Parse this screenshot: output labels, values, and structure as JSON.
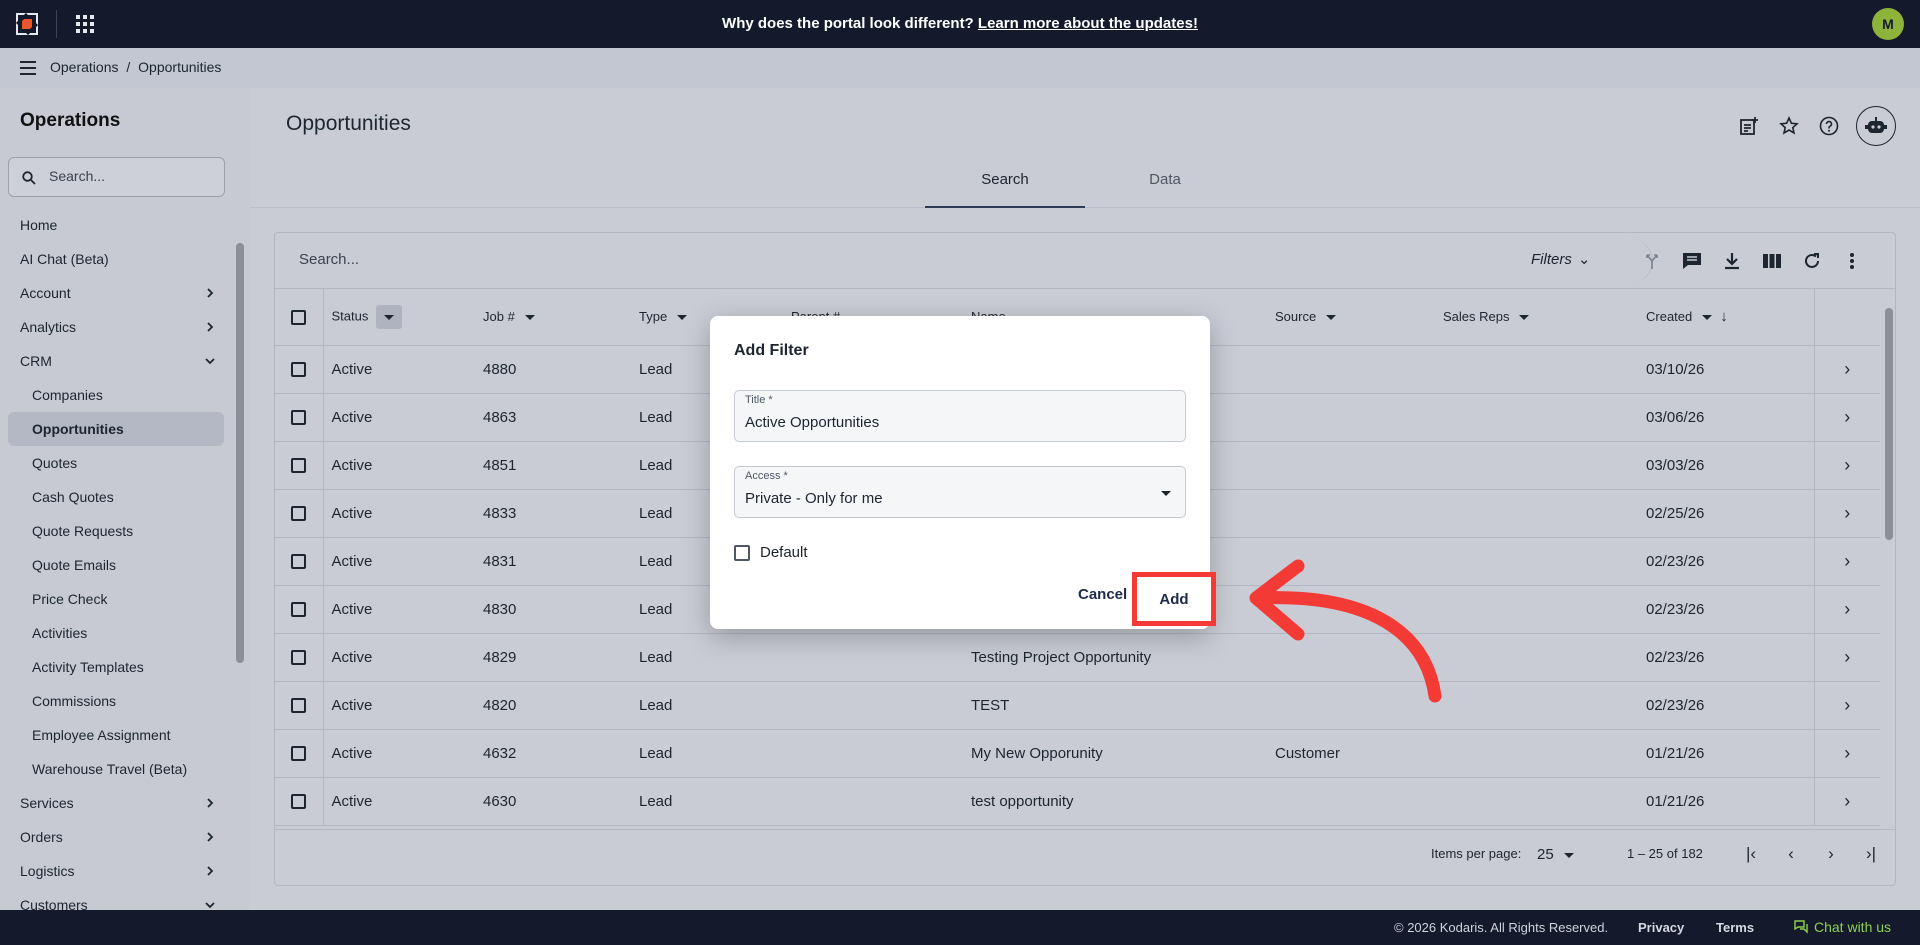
{
  "topbar": {
    "notice_text": "Why does the portal look different?",
    "notice_link": "Learn more about the updates!",
    "avatar_initial": "M"
  },
  "breadcrumb": {
    "root": "Operations",
    "separator": "/",
    "current": "Opportunities"
  },
  "sidebar": {
    "title": "Operations",
    "search_placeholder": "Search...",
    "items": [
      {
        "label": "Home",
        "level": 0
      },
      {
        "label": "AI Chat (Beta)",
        "level": 0
      },
      {
        "label": "Account",
        "level": 0,
        "chevron": "right"
      },
      {
        "label": "Analytics",
        "level": 0,
        "chevron": "right"
      },
      {
        "label": "CRM",
        "level": 0,
        "chevron": "down"
      },
      {
        "label": "Companies",
        "level": 1
      },
      {
        "label": "Opportunities",
        "level": 1,
        "active": true
      },
      {
        "label": "Quotes",
        "level": 1
      },
      {
        "label": "Cash Quotes",
        "level": 1
      },
      {
        "label": "Quote Requests",
        "level": 1
      },
      {
        "label": "Quote Emails",
        "level": 1
      },
      {
        "label": "Price Check",
        "level": 1
      },
      {
        "label": "Activities",
        "level": 1
      },
      {
        "label": "Activity Templates",
        "level": 1
      },
      {
        "label": "Commissions",
        "level": 1
      },
      {
        "label": "Employee Assignment",
        "level": 1
      },
      {
        "label": "Warehouse Travel (Beta)",
        "level": 1
      },
      {
        "label": "Services",
        "level": 0,
        "chevron": "right"
      },
      {
        "label": "Orders",
        "level": 0,
        "chevron": "right"
      },
      {
        "label": "Logistics",
        "level": 0,
        "chevron": "right"
      },
      {
        "label": "Customers",
        "level": 0,
        "chevron": "down"
      }
    ]
  },
  "main": {
    "page_title": "Opportunities",
    "tabs": [
      {
        "label": "Search",
        "active": true
      },
      {
        "label": "Data",
        "active": false
      }
    ],
    "search_placeholder": "Search...",
    "filters_label": "Filters"
  },
  "table": {
    "columns": [
      "Status",
      "Job #",
      "Type",
      "Parent #",
      "Name",
      "Source",
      "Sales Reps",
      "Created"
    ],
    "rows": [
      {
        "status": "Active",
        "job": "4880",
        "type": "Lead",
        "name": "",
        "source": "",
        "created": "03/10/26"
      },
      {
        "status": "Active",
        "job": "4863",
        "type": "Lead",
        "name": "",
        "source": "",
        "created": "03/06/26"
      },
      {
        "status": "Active",
        "job": "4851",
        "type": "Lead",
        "name": "",
        "source": "",
        "created": "03/03/26"
      },
      {
        "status": "Active",
        "job": "4833",
        "type": "Lead",
        "name": "",
        "source": "",
        "created": "02/25/26"
      },
      {
        "status": "Active",
        "job": "4831",
        "type": "Lead",
        "name": "",
        "source": "",
        "created": "02/23/26"
      },
      {
        "status": "Active",
        "job": "4830",
        "type": "Lead",
        "name": "",
        "source": "",
        "created": "02/23/26"
      },
      {
        "status": "Active",
        "job": "4829",
        "type": "Lead",
        "name": "Testing Project Opportunity",
        "source": "",
        "created": "02/23/26"
      },
      {
        "status": "Active",
        "job": "4820",
        "type": "Lead",
        "name": "TEST",
        "source": "",
        "created": "02/23/26"
      },
      {
        "status": "Active",
        "job": "4632",
        "type": "Lead",
        "name": "My New Opporunity",
        "source": "Customer",
        "created": "01/21/26"
      },
      {
        "status": "Active",
        "job": "4630",
        "type": "Lead",
        "name": "test opportunity",
        "source": "",
        "created": "01/21/26"
      }
    ]
  },
  "pager": {
    "items_per_page_label": "Items per page:",
    "items_per_page_value": "25",
    "range": "1 – 25 of 182"
  },
  "dialog": {
    "title": "Add Filter",
    "title_field_label": "Title *",
    "title_field_value": "Active Opportunities",
    "access_field_label": "Access *",
    "access_field_value": "Private - Only for me",
    "default_label": "Default",
    "cancel_label": "Cancel",
    "add_label": "Add"
  },
  "footer": {
    "copyright": "© 2026 Kodaris. All Rights Reserved.",
    "privacy": "Privacy",
    "terms": "Terms",
    "chat": "Chat with us"
  },
  "colors": {
    "topbar_bg": "#14192b",
    "highlight": "#f43a35",
    "avatar": "#8db33a",
    "chat": "#8ed14f"
  }
}
